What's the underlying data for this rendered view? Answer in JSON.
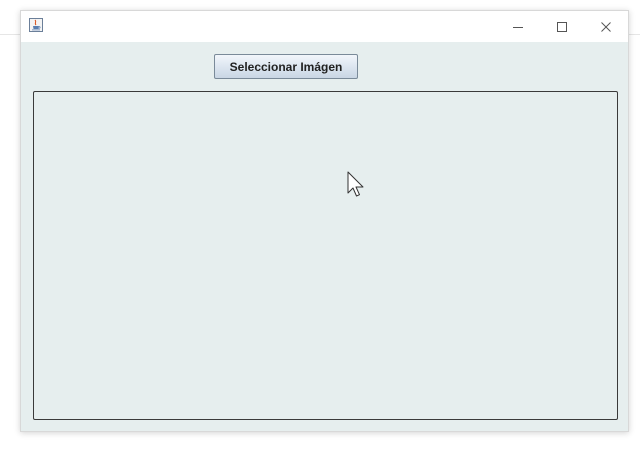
{
  "window": {
    "title": "",
    "icon": "java-coffee-icon",
    "controls": {
      "minimize_icon": "minimize-icon",
      "maximize_icon": "maximize-icon",
      "close_icon": "close-icon"
    }
  },
  "toolbar": {
    "select_image_label": "Seleccionar Imágen"
  },
  "image_panel": {
    "content": ""
  },
  "colors": {
    "window_bg": "#e6eeee",
    "titlebar_bg": "#ffffff",
    "panel_border": "#3a3a3a",
    "button_border": "#7a8a99"
  }
}
